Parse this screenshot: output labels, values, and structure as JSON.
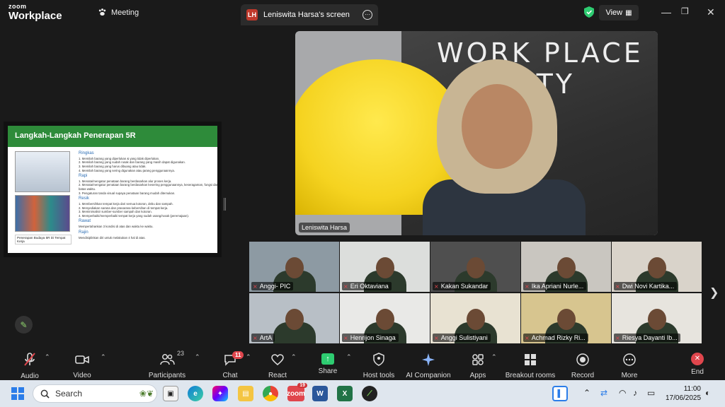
{
  "titlebar": {
    "logo_top": "zoom",
    "logo_bottom": "Workplace",
    "meeting_tab": "Meeting",
    "share_badge": "LH",
    "share_tab": "Leniswita Harsa's screen",
    "view_label": "View"
  },
  "slide": {
    "title": "Langkah-Langkah Penerapan 5R",
    "caption": "Penerapan Budaya 5R Di Tempat Kerja",
    "sections": [
      {
        "heading": "Ringkas",
        "lines": [
          "1. Memilah barang yang diperlukan & yang tidak diperlukan.",
          "2. Memilah barang yang sudah rusak dan barang yang masih dapat digunakan.",
          "3. Memilah barang yang harus dibuang atau tidak.",
          "4. Memilah barang yang sering digunakan atau jarang penggunaannya."
        ]
      },
      {
        "heading": "Rapi",
        "lines": [
          "1. Menata/mengatur penataan barang berdasarkan alur proses kerja.",
          "2. Menata/mengatur penataan barang berdasarkan kesering penggunaannya, keseragaman, fungsi dan batas waktu.",
          "3. Pengaturan tanda visual supaya penataan barang mudah ditemukan."
        ]
      },
      {
        "heading": "Resik",
        "lines": [
          "1. Membersihkan tempat kerja dari semua kotoran, debu dan sampah.",
          "2. Menyediakan sarana dan prasarana kebersihan di tempat kerja.",
          "3. Meminimalisir sumber-sumber sampah dan kotoran.",
          "4. Memperbaiki/memperbaiki tempat kerja yang sudah usang/rusak (peremajaan)."
        ]
      },
      {
        "heading": "Rawat",
        "lines": [
          "Mempertahankan 3 kondisi di atas dan waktu ke waktu."
        ]
      },
      {
        "heading": "Rajin",
        "lines": [
          "Mendisiplinkan diri untuk melakukan 4 hal di atas."
        ]
      }
    ]
  },
  "main_video": {
    "board_text": "WORK PLACE\n       ETY",
    "name": "Leniswita Harsa"
  },
  "gallery": {
    "participants": [
      {
        "name": "Anggi- PIC",
        "bg": "#8d9aa3"
      },
      {
        "name": "Eri Oktaviana",
        "bg": "#dcdedc"
      },
      {
        "name": "Kakan Sukandar",
        "bg": "#4f4f4f"
      },
      {
        "name": "Ika Apriani Nurle...",
        "bg": "#c9c6c0"
      },
      {
        "name": "Dwi Novi Kartika...",
        "bg": "#d9d3ca"
      },
      {
        "name": "ArtA",
        "bg": "#b8bfc6"
      },
      {
        "name": "Henrijon Sinaga",
        "bg": "#e9e9e7"
      },
      {
        "name": "Anggi Sulistiyani",
        "bg": "#e8e2d2"
      },
      {
        "name": "Achmad Rizky Ri...",
        "bg": "#d7c58f"
      },
      {
        "name": "Riesya Dayanti Ib...",
        "bg": "#e7e4de"
      }
    ]
  },
  "toolbar": {
    "audio": "Audio",
    "video": "Video",
    "participants": "Participants",
    "participants_count": "23",
    "chat": "Chat",
    "chat_badge": "11",
    "react": "React",
    "share": "Share",
    "host_tools": "Host tools",
    "ai_companion": "AI Companion",
    "apps": "Apps",
    "breakout": "Breakout rooms",
    "record": "Record",
    "more": "More",
    "end": "End"
  },
  "taskbar": {
    "search": "Search",
    "zoom_badge": "19",
    "time": "11:00",
    "date": "17/06/2025"
  },
  "icons": {
    "start": "windows-start-icon",
    "search": "search-icon",
    "mic": "mic-muted-icon"
  },
  "colors": {
    "slide_header": "#2e8b3a",
    "mute_red": "#e0464d",
    "share_green": "#2ecc71"
  }
}
